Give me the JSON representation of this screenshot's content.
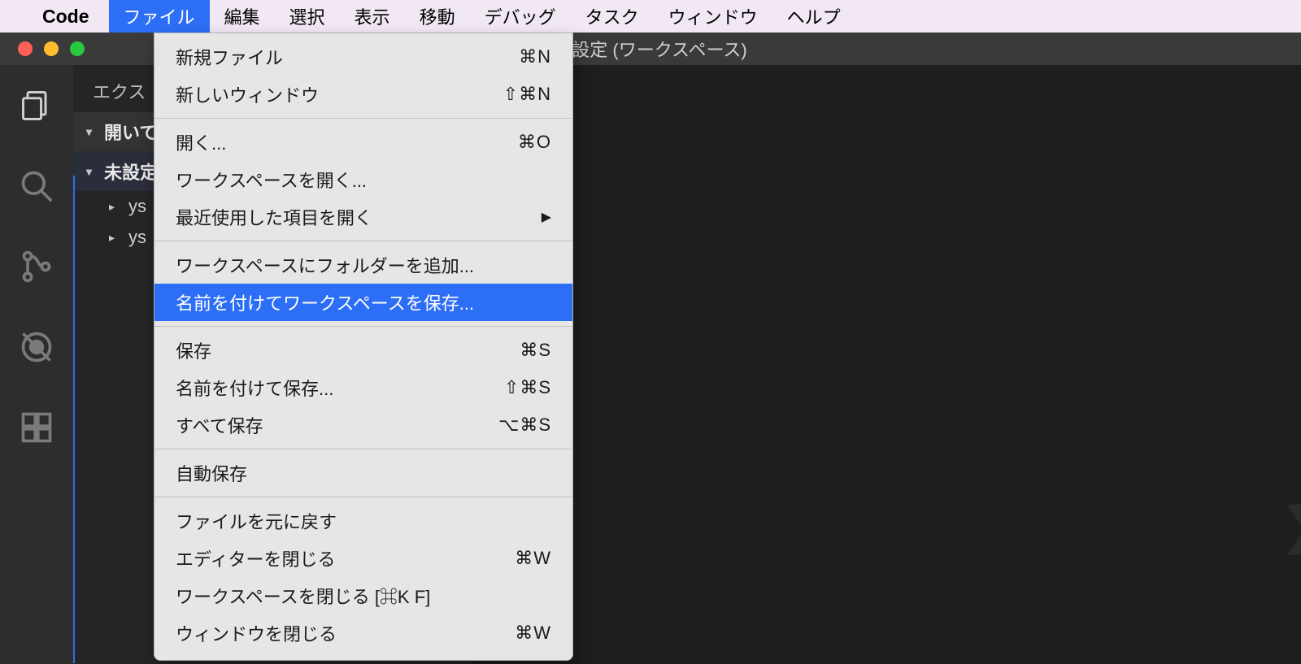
{
  "menubar": {
    "app": "Code",
    "items": [
      "ファイル",
      "編集",
      "選択",
      "表示",
      "移動",
      "デバッグ",
      "タスク",
      "ウィンドウ",
      "ヘルプ"
    ],
    "active_index": 0
  },
  "window": {
    "title": "未設定 (ワークスペース)"
  },
  "sidebar": {
    "title": "エクス",
    "sections": [
      {
        "label": "開いて",
        "expanded": true
      },
      {
        "label": "未設定",
        "expanded": true
      }
    ],
    "tree": [
      {
        "label": "ys"
      },
      {
        "label": "ys"
      }
    ]
  },
  "dropdown": {
    "groups": [
      [
        {
          "label": "新規ファイル",
          "shortcut": "⌘N"
        },
        {
          "label": "新しいウィンドウ",
          "shortcut": "⇧⌘N"
        }
      ],
      [
        {
          "label": "開く...",
          "shortcut": "⌘O"
        },
        {
          "label": "ワークスペースを開く..."
        },
        {
          "label": "最近使用した項目を開く",
          "submenu": true
        }
      ],
      [
        {
          "label": "ワークスペースにフォルダーを追加..."
        },
        {
          "label": "名前を付けてワークスペースを保存...",
          "highlight": true
        }
      ],
      [
        {
          "label": "保存",
          "shortcut": "⌘S"
        },
        {
          "label": "名前を付けて保存...",
          "shortcut": "⇧⌘S"
        },
        {
          "label": "すべて保存",
          "shortcut": "⌥⌘S"
        }
      ],
      [
        {
          "label": "自動保存"
        }
      ],
      [
        {
          "label": "ファイルを元に戻す"
        },
        {
          "label": "エディターを閉じる",
          "shortcut": "⌘W"
        },
        {
          "label": "ワークスペースを閉じる [⌘K F]"
        },
        {
          "label": "ウィンドウを閉じる",
          "shortcut": "⌘W"
        }
      ]
    ]
  }
}
